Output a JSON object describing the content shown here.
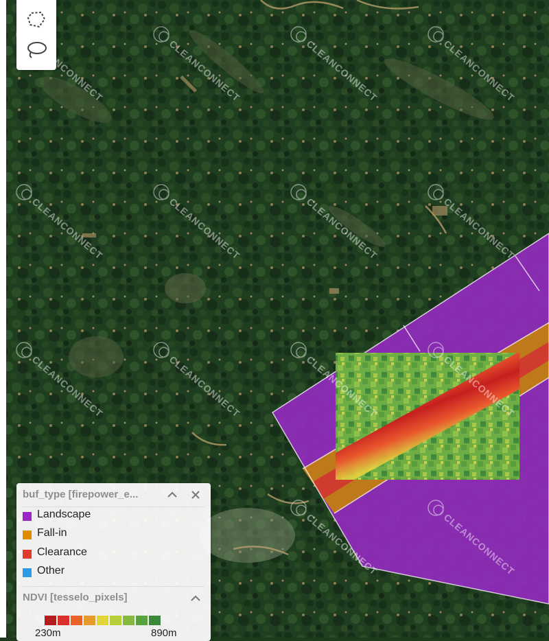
{
  "toolbar": {
    "tools": [
      {
        "icon": "polygon-select-icon"
      },
      {
        "icon": "freehand-lasso-icon"
      }
    ]
  },
  "map": {
    "watermark": "CLEANCONNECT",
    "buffer_colors": {
      "landscape": "#8e2bb8",
      "fall_in": "#c07d12",
      "clearance": "#cf3b2e"
    }
  },
  "legend": {
    "layer_title": "buf_type [firepower_e...",
    "items": [
      {
        "label": "Landscape",
        "color": "#9b27c6"
      },
      {
        "label": "Fall-in",
        "color": "#e08a00"
      },
      {
        "label": "Clearance",
        "color": "#e03a2f"
      },
      {
        "label": "Other",
        "color": "#2e9be6"
      }
    ],
    "ndvi": {
      "title": "NDVI [tesselo_pixels]",
      "ramp_colors": [
        "#b21e1e",
        "#d9302a",
        "#e8622a",
        "#e79a2c",
        "#e2d43a",
        "#b8cf3a",
        "#86b83e",
        "#5aa23e",
        "#3b8a3a"
      ],
      "min_label": "230m",
      "max_label": "890m"
    }
  }
}
